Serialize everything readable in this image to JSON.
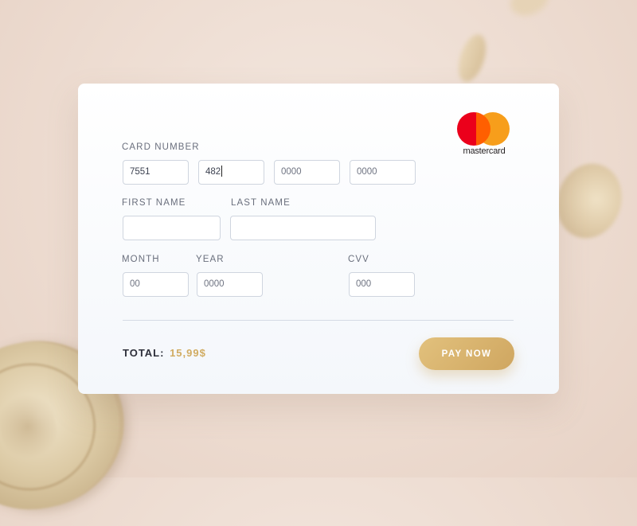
{
  "brand": {
    "logo_text": "mastercard",
    "colors": {
      "red": "#eb001b",
      "orange": "#f79e1b",
      "overlap": "#ff5f00"
    }
  },
  "form": {
    "card_number_label": "CARD NUMBER",
    "card_number_groups": [
      "7551",
      "482",
      "0000",
      "0000"
    ],
    "first_name_label": "FIRST NAME",
    "first_name_value": "",
    "last_name_label": "LAST NAME",
    "last_name_value": "",
    "month_label": "MONTH",
    "month_value": "00",
    "year_label": "YEAR",
    "year_value": "0000",
    "cvv_label": "CVV",
    "cvv_value": "000"
  },
  "footer": {
    "total_label": "TOTAL:",
    "total_amount": "15,99$",
    "pay_button_label": "PAY NOW"
  },
  "colors": {
    "accent_gold": "#d1ac62",
    "button_start": "#e2c17d",
    "button_end": "#cfa660"
  }
}
